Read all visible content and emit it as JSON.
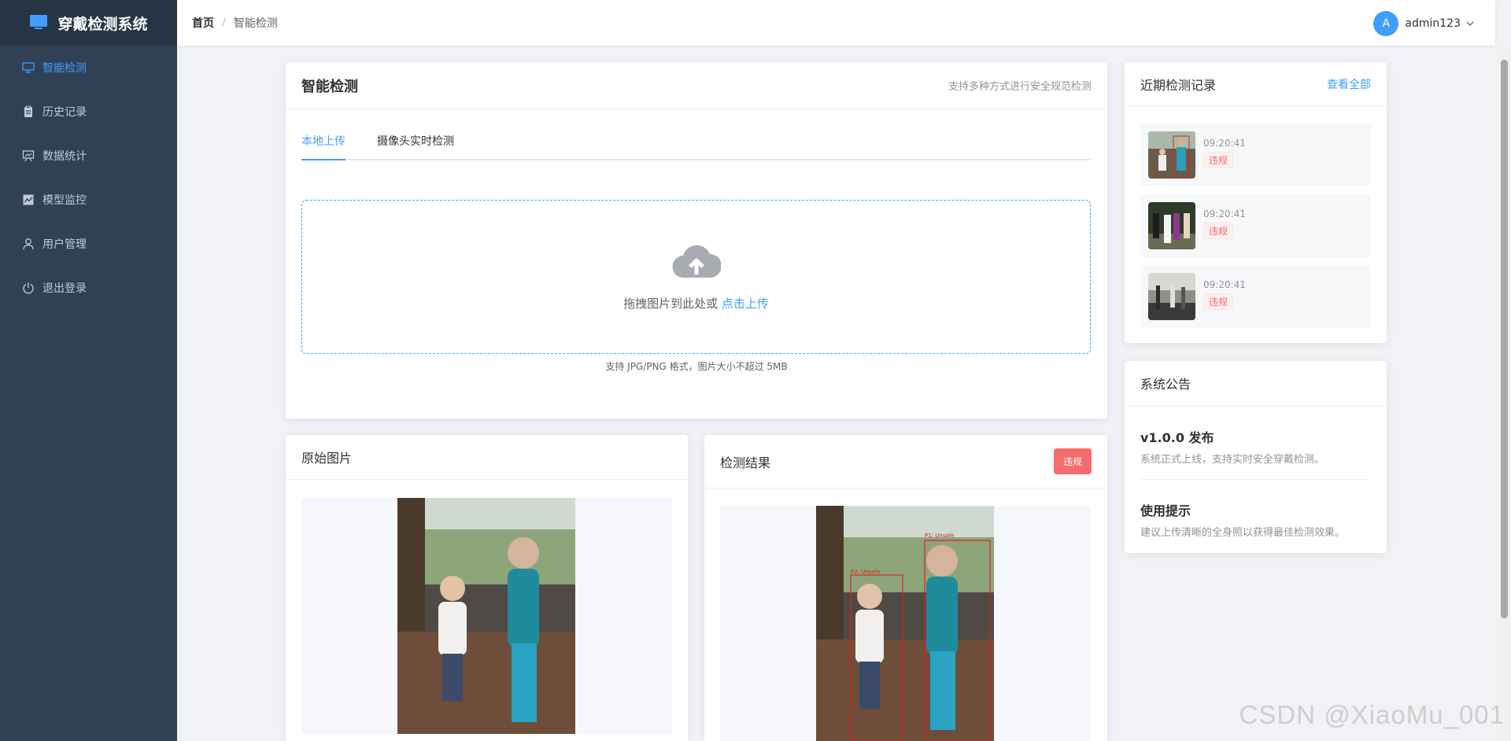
{
  "app": {
    "title": "穿戴检测系统"
  },
  "sidebar": {
    "items": [
      {
        "label": "智能检测",
        "icon": "monitor-icon",
        "active": true
      },
      {
        "label": "历史记录",
        "icon": "clipboard-icon",
        "active": false
      },
      {
        "label": "数据统计",
        "icon": "chart-board-icon",
        "active": false
      },
      {
        "label": "模型监控",
        "icon": "line-chart-icon",
        "active": false
      },
      {
        "label": "用户管理",
        "icon": "user-icon",
        "active": false
      },
      {
        "label": "退出登录",
        "icon": "power-icon",
        "active": false
      }
    ]
  },
  "header": {
    "breadcrumb_home": "首页",
    "breadcrumb_sep": "/",
    "breadcrumb_current": "智能检测",
    "avatar_letter": "A",
    "username": "admin123"
  },
  "detect": {
    "title": "智能检测",
    "subtitle": "支持多种方式进行安全规范检测",
    "tabs": [
      {
        "label": "本地上传",
        "active": true
      },
      {
        "label": "摄像头实时检测",
        "active": false
      }
    ],
    "upload_text": "拖拽图片到此处或",
    "upload_link": "点击上传",
    "upload_tip": "支持 JPG/PNG 格式，图片大小不超过 5MB"
  },
  "original": {
    "title": "原始图片"
  },
  "result": {
    "title": "检测结果",
    "status_badge": "违规",
    "box_labels": [
      "P1: Unsafe",
      "P2: Unsafe"
    ]
  },
  "recent": {
    "title": "近期检测记录",
    "view_all": "查看全部",
    "items": [
      {
        "time": "09:20:41",
        "tag": "违规"
      },
      {
        "time": "09:20:41",
        "tag": "违规"
      },
      {
        "time": "09:20:41",
        "tag": "违规"
      }
    ]
  },
  "notice": {
    "title": "系统公告",
    "items": [
      {
        "title": "v1.0.0 发布",
        "desc": "系统正式上线，支持实时安全穿戴检测。"
      },
      {
        "title": "使用提示",
        "desc": "建议上传清晰的全身照以获得最佳检测效果。"
      }
    ]
  },
  "watermark": "CSDN @XiaoMu_001",
  "colors": {
    "accent": "#409eff",
    "danger": "#f56c6c",
    "sidebar_bg": "#304156"
  }
}
